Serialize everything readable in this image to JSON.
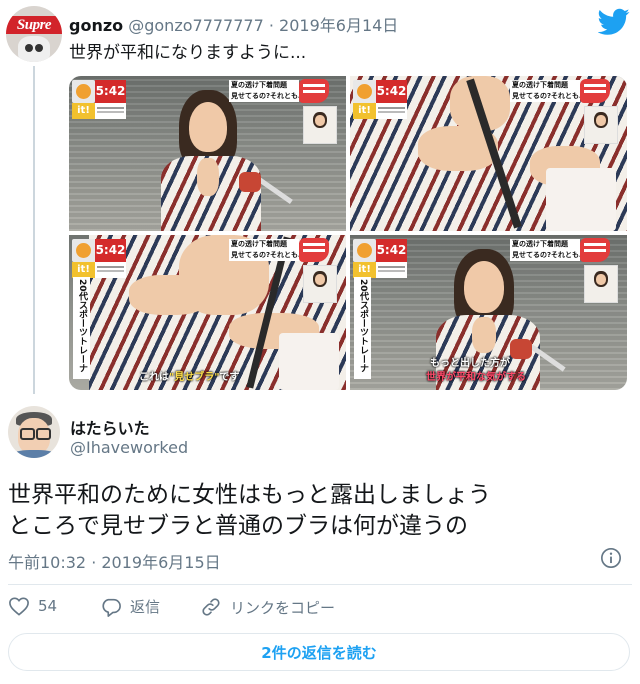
{
  "quoted_tweet": {
    "display_name": "gonzo",
    "handle": "@gonzo7777777",
    "date": "2019年6月14日",
    "text": "世界が平和になりますように...",
    "avatar_text": "Supre",
    "images": [
      {
        "time": "5:42",
        "it_badge": "it!",
        "caption_line1": "夏の透け下着問題",
        "caption_line2": "見せてるの?それとも…?"
      },
      {
        "time": "5:42",
        "it_badge": "it!",
        "caption_line1": "夏の透け下着問題",
        "caption_line2": "見せてるの?それとも…?"
      },
      {
        "time": "5:42",
        "it_badge": "it!",
        "caption_line1": "夏の透け下着問題",
        "caption_line2": "見せてるの?それとも…?",
        "vertical_banner": "20代スポーツトレーナー",
        "subtitle_pre": "これは",
        "subtitle_hl": "\"見せブラ\"",
        "subtitle_post": "です"
      },
      {
        "time": "5:42",
        "it_badge": "it!",
        "caption_line1": "夏の透け下着問題",
        "caption_line2": "見せてるの?それとも…?",
        "vertical_banner": "20代スポーツトレーナー",
        "subtitle_line1": "もっと出した方が",
        "subtitle_line2": "世界が平和な気がする"
      }
    ]
  },
  "main_tweet": {
    "display_name": "はたらいた",
    "handle": "@Ihaveworked",
    "text_line1": "世界平和のために女性はもっと露出しましょう",
    "text_line2": "ところで見せブラと普通のブラは何が違うの",
    "timestamp": "午前10:32 · 2019年6月15日"
  },
  "actions": {
    "like_count": "54",
    "reply_label": "返信",
    "copy_link_label": "リンクをコピー"
  },
  "read_replies_label": "2件の返信を読む",
  "icons": {
    "brand": "twitter-bird-icon",
    "info": "info-icon",
    "like": "heart-icon",
    "reply": "reply-bubble-icon",
    "copy_link": "link-icon"
  },
  "colors": {
    "twitter_blue": "#1da1f2",
    "secondary_text": "#657786",
    "primary_text": "#14171a",
    "border": "#e1e8ed"
  }
}
